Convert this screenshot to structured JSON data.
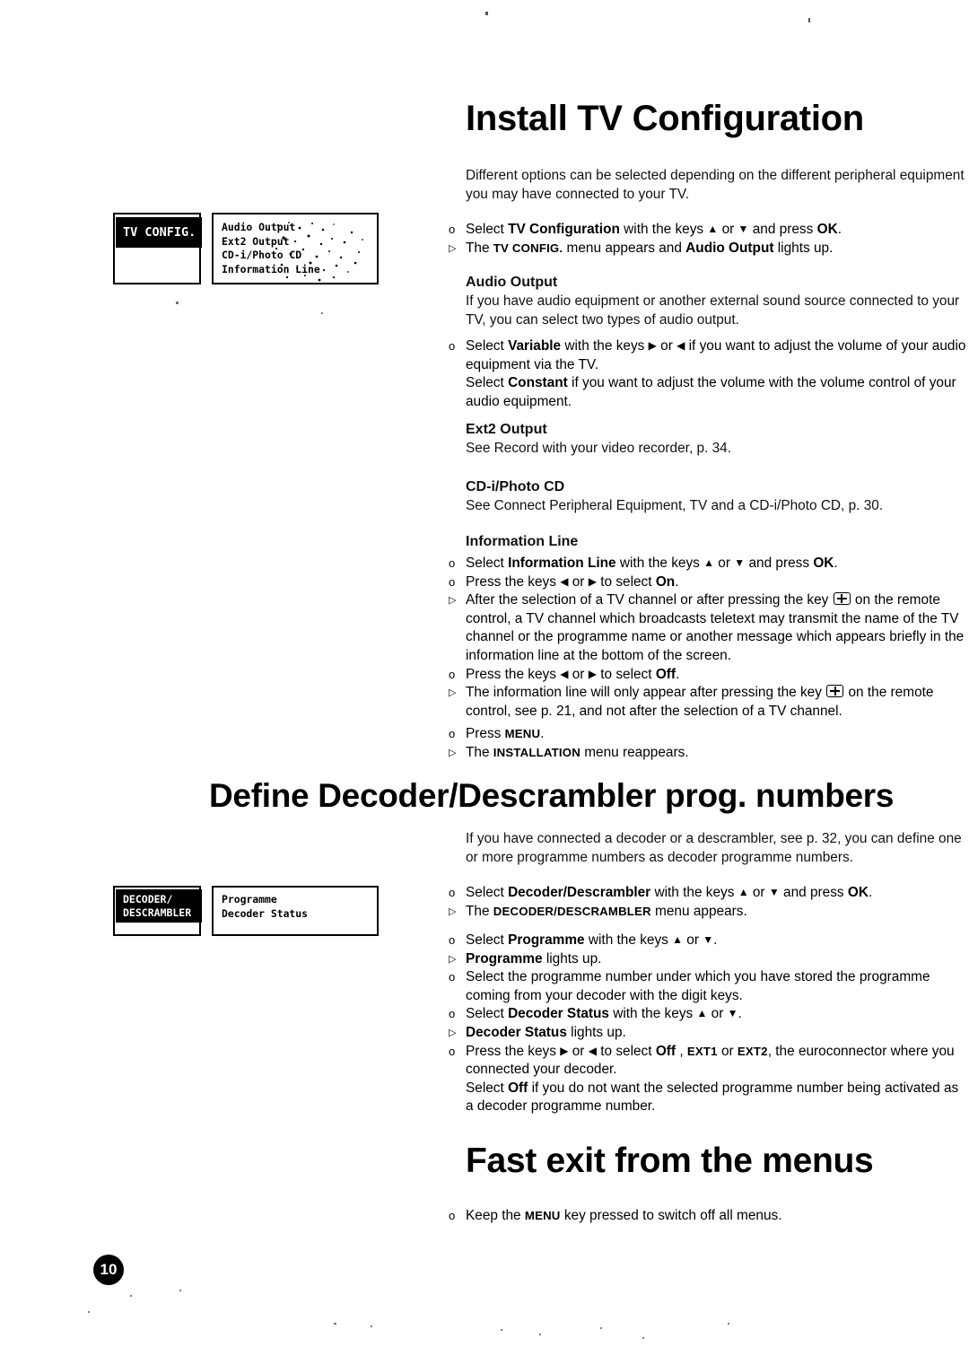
{
  "page": {
    "number": "10"
  },
  "sections": {
    "install": {
      "heading": "Install TV Configuration",
      "intro": "Different options can be selected depending on the different peripheral equipment you may have connected to your TV.",
      "steps": [
        {
          "marker": "o",
          "text_parts": [
            "Select ",
            "TV Configuration",
            " with the keys ",
            "▲",
            " or ",
            "▼",
            " and press ",
            "OK",
            "."
          ]
        },
        {
          "marker": "▷",
          "text_parts": [
            "The ",
            "TV CONFIG.",
            " menu appears and ",
            "Audio Output",
            " lights up."
          ]
        }
      ],
      "subsections": [
        {
          "title": "Audio Output",
          "body": "If you have audio equipment or another external sound source connected to your TV, you can select two types of audio output.",
          "bullet_marker": "o",
          "bullet_line1": "Select Variable with the keys ▶ or ◀ if you want to adjust the volume of your audio equipment via the TV.",
          "bullet_line2": "Select Constant if you want to adjust the volume with the volume control of your audio equipment."
        },
        {
          "title": "Ext2 Output",
          "body": "See Record with your video recorder, p. 34."
        },
        {
          "title": "CD-i/Photo CD",
          "body": "See Connect Peripheral Equipment, TV and a CD-i/Photo CD, p. 30."
        },
        {
          "title": "Information Line",
          "body": ""
        }
      ],
      "infoline_steps": [
        {
          "marker": "o",
          "text": "Select Information Line with the keys ▲ or ▼ and press OK."
        },
        {
          "marker": "o",
          "text": "Press the keys ◀ or ▶ to select On."
        },
        {
          "marker": "▷",
          "text": "After the selection of a TV channel or after pressing the key [+] on the remote control, a TV channel which broadcasts teletext may transmit the name of the TV channel or the programme name or another message which appears briefly in the information line at the bottom of the screen."
        },
        {
          "marker": "o",
          "text": "Press the keys ◀ or ▶ to select Off."
        },
        {
          "marker": "▷",
          "text": "The information line will only appear after pressing the key [+] on the remote control, see p. 21, and not after the selection of a TV channel."
        }
      ],
      "closing_steps": [
        {
          "marker": "o",
          "text": "Press MENU."
        },
        {
          "marker": "▷",
          "text": "The INSTALLATION menu reappears."
        }
      ],
      "menu_graphic": {
        "highlight_label": "TV CONFIG.",
        "items": [
          "Audio Output",
          "Ext2 Output",
          "CD-i/Photo CD",
          "Information Line"
        ]
      }
    },
    "decoder": {
      "heading": "Define Decoder/Descrambler prog. numbers",
      "intro": "If you have connected a decoder or a descrambler, see p. 32, you can define one or more programme numbers as decoder programme numbers.",
      "steps_group1": [
        {
          "marker": "o",
          "text": "Select Decoder/Descrambler with the keys ▲ or ▼ and press OK."
        },
        {
          "marker": "▷",
          "text": "The DECODER/DESCRAMBLER menu appears."
        }
      ],
      "steps_group2": [
        {
          "marker": "o",
          "text": "Select Programme with the keys ▲ or ▼."
        },
        {
          "marker": "▷",
          "text": "Programme lights up."
        },
        {
          "marker": "o",
          "text": "Select the programme number under which you have stored the programme coming from your decoder with the digit keys."
        },
        {
          "marker": "o",
          "text": "Select Decoder Status with the keys ▲ or ▼."
        },
        {
          "marker": "▷",
          "text": "Decoder Status lights up."
        },
        {
          "marker": "o",
          "text": "Press the keys ▶ or ◀ to select Off , EXT1 or EXT2, the euroconnector where you connected your decoder."
        },
        {
          "marker": "",
          "text": "Select Off if you do not want the selected programme number being activated as a decoder programme number."
        }
      ],
      "menu_graphic": {
        "highlight_label_line1": "DECODER/",
        "highlight_label_line2": "DESCRAMBLER",
        "items": [
          "Programme",
          "Decoder Status"
        ]
      }
    },
    "fastexit": {
      "heading": "Fast exit from the menus",
      "steps": [
        {
          "marker": "o",
          "text": "Keep the MENU key pressed to switch off all menus."
        }
      ]
    }
  },
  "glyphs": {
    "bullet_circle": "o",
    "bullet_triangle": "▷",
    "arrow_up": "▲",
    "arrow_down": "▼",
    "arrow_left": "◀",
    "arrow_right": "▶"
  }
}
